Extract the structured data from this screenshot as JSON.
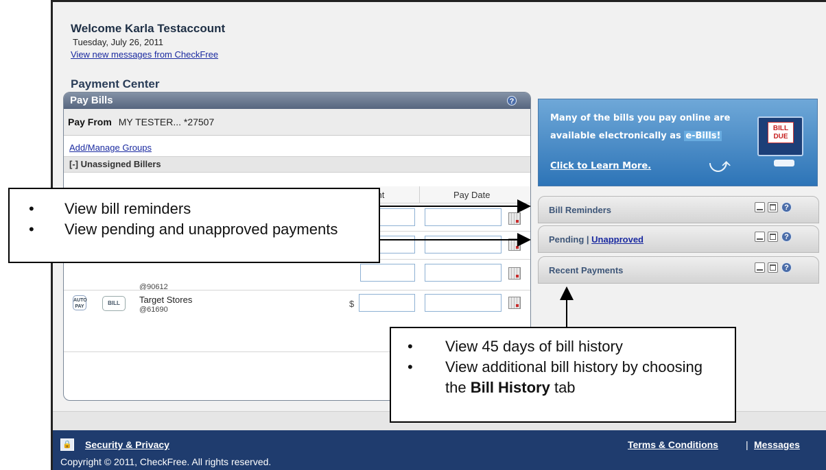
{
  "header": {
    "welcome": "Welcome Karla Testaccount",
    "date": "Tuesday, July 26, 2011",
    "messages_link": "View new messages from CheckFree",
    "section_title": "Payment Center"
  },
  "pay_bills": {
    "title": "Pay Bills",
    "help": "?",
    "pay_from_label": "Pay From",
    "pay_from_value": "MY TESTER... *27507",
    "add_manage_groups": "Add/Manage Groups",
    "unassigned_toggle": "[-]",
    "unassigned_label": "Unassigned Billers",
    "col_amount": "ount",
    "col_pay_date": "Pay Date",
    "rows": [
      {
        "biller": "",
        "account": "@90612",
        "dollar": ""
      },
      {
        "biller": "Target Stores",
        "account": "@61690",
        "dollar": "$"
      }
    ],
    "autopay_label": "AUTO PAY",
    "bill_button_label": "BILL"
  },
  "ebills_banner": {
    "line1": "Many of the bills you pay online are",
    "line2_prefix": "available electronically as ",
    "line2_highlight": "e-Bills!",
    "line3": "Click to Learn More.",
    "badge_line1": "BILL",
    "badge_line2": "DUE"
  },
  "widgets": {
    "bill_reminders": "Bill Reminders",
    "pending": "Pending",
    "pending_sep": " | ",
    "unapproved": "Unapproved",
    "recent_payments": "Recent Payments"
  },
  "callouts": {
    "left": [
      "View bill reminders",
      "View pending and unapproved payments"
    ],
    "bottom_1": "View 45 days of bill history",
    "bottom_2_prefix": "View additional bill history by choosing the ",
    "bottom_2_bold": "Bill History",
    "bottom_2_suffix": " tab"
  },
  "footer": {
    "security": "Security & Privacy",
    "terms": "Terms & Conditions",
    "separator": "|",
    "messages": "Messages",
    "copyright": "Copyright © 2011, CheckFree. All rights reserved."
  },
  "colors": {
    "footer_bg": "#1f3c6e",
    "banner_blue": "#2d74b7",
    "link": "#1a2aa0"
  }
}
